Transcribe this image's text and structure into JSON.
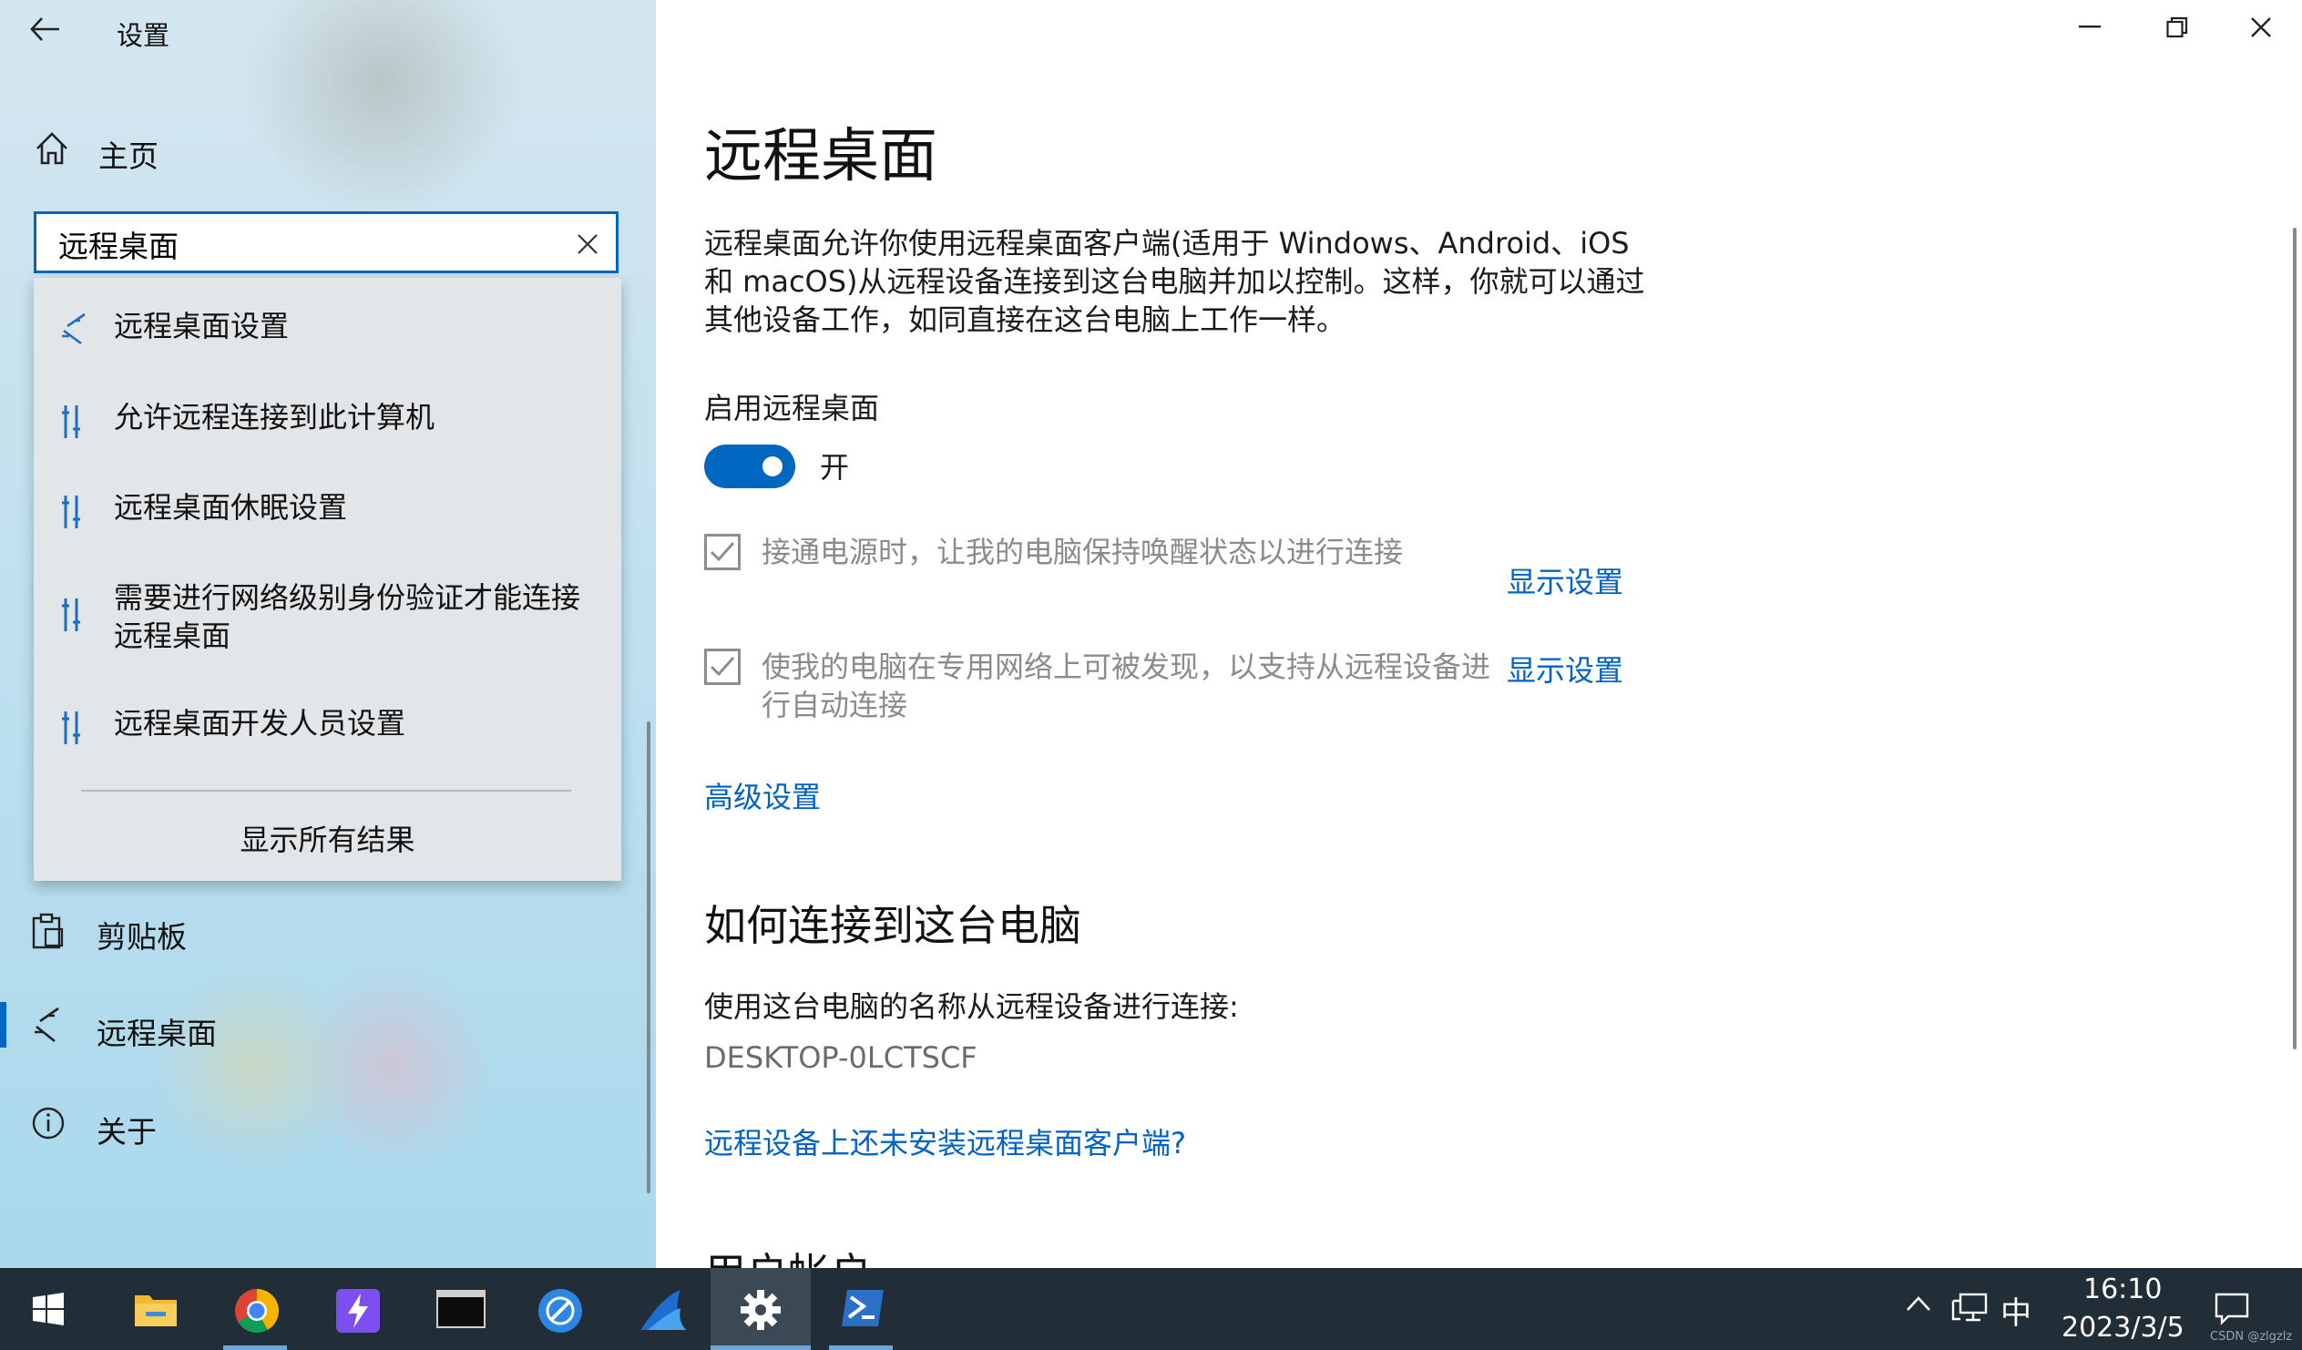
{
  "window": {
    "title": "设置",
    "controls": {
      "minimize": "minimize-icon",
      "restore": "restore-icon",
      "close": "close-icon"
    }
  },
  "sidebar": {
    "home_label": "主页",
    "search": {
      "value": "远程桌面",
      "placeholder": ""
    },
    "items": [
      {
        "label": "剪贴板",
        "icon": "clipboard-icon"
      },
      {
        "label": "远程桌面",
        "icon": "remote-desktop-icon",
        "selected": true
      },
      {
        "label": "关于",
        "icon": "info-icon"
      }
    ]
  },
  "suggestions": {
    "items": [
      {
        "label": "远程桌面设置",
        "icon": "remote-desktop-icon"
      },
      {
        "label": "允许远程连接到此计算机",
        "icon": "settings-tool-icon"
      },
      {
        "label": "远程桌面休眠设置",
        "icon": "settings-tool-icon"
      },
      {
        "label_line1": "需要进行网络级别身份验证才能连接",
        "label_line2": "远程桌面",
        "icon": "settings-tool-icon"
      },
      {
        "label": "远程桌面开发人员设置",
        "icon": "settings-tool-icon"
      }
    ],
    "show_all": "显示所有结果"
  },
  "main": {
    "title": "远程桌面",
    "description_lines": [
      "远程桌面允许你使用远程桌面客户端(适用于 Windows、Android、iOS",
      "和 macOS)从远程设备连接到这台电脑并加以控制。这样，你就可以通过",
      "其他设备工作，如同直接在这台电脑上工作一样。"
    ],
    "enable_label": "启用远程桌面",
    "toggle_state": "开",
    "toggle_on": true,
    "option1": {
      "text": "接通电源时，让我的电脑保持唤醒状态以进行连接",
      "checked": true,
      "link": "显示设置"
    },
    "option2": {
      "line1": "使我的电脑在专用网络上可被发现，以支持从远程设备进",
      "line2": "行自动连接",
      "checked": true,
      "link": "显示设置"
    },
    "advanced_link": "高级设置",
    "section_heading": "如何连接到这台电脑",
    "connect_label": "使用这台电脑的名称从远程设备进行连接:",
    "pc_name": "DESKTOP-0LCTSCF",
    "client_link": "远程设备上还未安装远程桌面客户端?",
    "partial_heading": "用户帐户"
  },
  "taskbar": {
    "apps": [
      {
        "name": "start",
        "icon": "windows-logo-icon"
      },
      {
        "name": "file-explorer",
        "icon": "folder-icon"
      },
      {
        "name": "chrome",
        "icon": "chrome-icon",
        "running": true
      },
      {
        "name": "app-lightning",
        "icon": "lightning-app-icon"
      },
      {
        "name": "terminal",
        "icon": "terminal-icon"
      },
      {
        "name": "app-compass",
        "icon": "compass-app-icon"
      },
      {
        "name": "app-shark",
        "icon": "shark-fin-icon"
      },
      {
        "name": "settings",
        "icon": "gear-icon",
        "running": true,
        "active": true
      },
      {
        "name": "powershell",
        "icon": "powershell-icon",
        "running": true
      }
    ],
    "tray": {
      "ime": "中",
      "time": "16:10",
      "date": "2023/3/5",
      "watermark": "CSDN @zlgzlz"
    }
  },
  "colors": {
    "accent": "#0067c0",
    "link": "#0062c4",
    "taskbar": "#212d37"
  }
}
